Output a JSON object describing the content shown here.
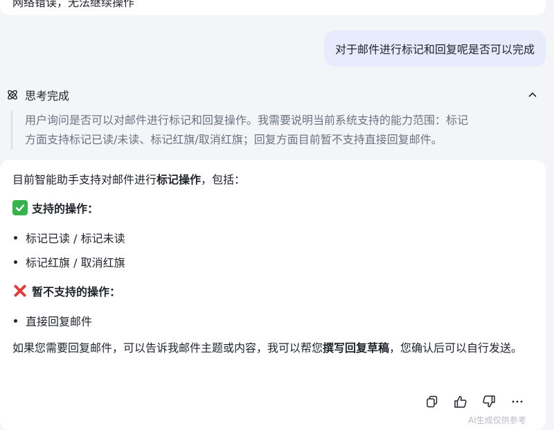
{
  "top_message": {
    "text": "网络错误，无法继续操作"
  },
  "user_message": {
    "text": "对于邮件进行标记和回复呢是否可以完成"
  },
  "thinking": {
    "title": "思考完成",
    "line1": "用户询问是否可以对邮件进行标记和回复操作。我需要说明当前系统支持的能力范围：标记",
    "line2": "方面支持标记已读/未读、标记红旗/取消红旗；回复方面目前暂不支持直接回复邮件。"
  },
  "answer": {
    "intro_pre": "目前智能助手支持对邮件进行",
    "intro_bold": "标记操作",
    "intro_post": "，包括：",
    "supported_title": "支持的操作：",
    "supported_items": [
      "标记已读 / 标记未读",
      "标记红旗 / 取消红旗"
    ],
    "unsupported_title": "暂不支持的操作：",
    "unsupported_items": [
      "直接回复邮件"
    ],
    "closing_pre": "如果您需要回复邮件，可以告诉我邮件主题或内容，我可以帮您",
    "closing_bold": "撰写回复草稿",
    "closing_post": "，您确认后可以自行发送。"
  },
  "footer": {
    "note": "AI生成仅供参考"
  },
  "icons": {
    "thinking": "brain-icon",
    "collapse": "chevron-up-icon",
    "copy": "copy-icon",
    "like": "thumbs-up-icon",
    "dislike": "thumbs-down-icon",
    "more": "more-icon",
    "check": "check-mark-icon",
    "cross": "cross-mark-icon"
  },
  "colors": {
    "check": "#36b34a",
    "cross": "#e53935",
    "user_bubble": "#e7ebfb"
  }
}
